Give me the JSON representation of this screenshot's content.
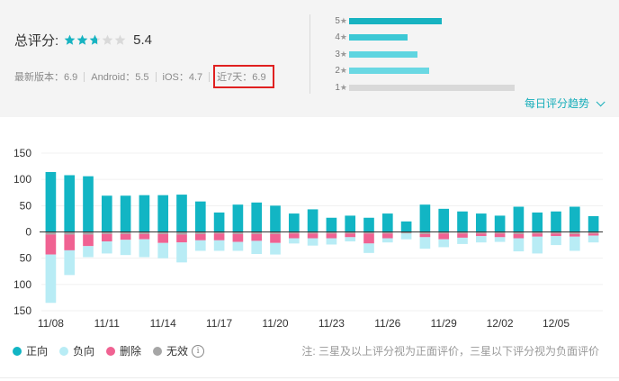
{
  "rating": {
    "label": "总评分:",
    "value": "5.4",
    "stars_filled": 2.7,
    "stars_total": 5,
    "star_color": "#17b3c1",
    "star_empty_color": "#d9d9d9"
  },
  "versions": {
    "latest": "最新版本：6.9",
    "android": "Android：5.5",
    "ios": "iOS：4.7",
    "recent": "近7天：6.9"
  },
  "distribution": [
    {
      "stars": "5",
      "value": 0.38,
      "color": "#17b3c1"
    },
    {
      "stars": "4",
      "value": 0.24,
      "color": "#3cc8d5"
    },
    {
      "stars": "3",
      "value": 0.28,
      "color": "#5fd5e0"
    },
    {
      "stars": "2",
      "value": 0.33,
      "color": "#6ad8e3"
    },
    {
      "stars": "1",
      "value": 0.68,
      "color": "#d9d9d9"
    }
  ],
  "trend_link": "每日评分趋势",
  "legend": {
    "positive": "正向",
    "negative": "负向",
    "deleted": "删除",
    "invalid": "无效"
  },
  "note": "注: 三星及以上评分视为正面评价，三星以下评分视为负面评价",
  "colors": {
    "positive": "#12b5c4",
    "negative": "#b8ecf5",
    "deleted": "#f06292",
    "invalid": "#a6a6a6",
    "accent": "#17aeba"
  },
  "chart_data": {
    "type": "bar",
    "stacked": true,
    "ylim": [
      -150,
      150
    ],
    "yticks": [
      150,
      100,
      50,
      0,
      50,
      100,
      150
    ],
    "ytick_values": [
      150,
      100,
      50,
      0,
      -50,
      -100,
      -150
    ],
    "xtick_labels": [
      "11/08",
      "11/11",
      "11/14",
      "11/17",
      "11/20",
      "11/23",
      "11/26",
      "11/29",
      "12/02",
      "12/05"
    ],
    "categories": [
      "11/08",
      "11/09",
      "11/10",
      "11/11",
      "11/12",
      "11/13",
      "11/14",
      "11/15",
      "11/16",
      "11/17",
      "11/18",
      "11/19",
      "11/20",
      "11/21",
      "11/22",
      "11/23",
      "11/24",
      "11/25",
      "11/26",
      "11/27",
      "11/28",
      "11/29",
      "11/30",
      "12/01",
      "12/02",
      "12/03",
      "12/04",
      "12/05",
      "12/06",
      "12/07"
    ],
    "series": [
      {
        "name": "正向",
        "values": [
          114,
          108,
          106,
          69,
          69,
          70,
          70,
          71,
          58,
          37,
          52,
          56,
          50,
          35,
          43,
          27,
          31,
          27,
          35,
          20,
          52,
          44,
          39,
          35,
          31,
          48,
          37,
          39,
          48,
          30
        ]
      },
      {
        "name": "无效",
        "values": [
          -5,
          -5,
          -5,
          -4,
          -4,
          -4,
          -4,
          -5,
          -4,
          -3,
          -4,
          -4,
          -4,
          -3,
          -3,
          -3,
          -3,
          -3,
          -3,
          -3,
          -4,
          -3,
          -3,
          -3,
          -3,
          -4,
          -3,
          -3,
          -4,
          -3
        ]
      },
      {
        "name": "删除",
        "values": [
          -38,
          -30,
          -22,
          -14,
          -11,
          -10,
          -17,
          -15,
          -12,
          -13,
          -15,
          -13,
          -17,
          -9,
          -9,
          -9,
          -7,
          -19,
          -9,
          0,
          -6,
          -11,
          -8,
          -5,
          -7,
          -8,
          -6,
          -5,
          -5,
          -4
        ]
      },
      {
        "name": "负向",
        "values": [
          -92,
          -47,
          -21,
          -23,
          -29,
          -34,
          -29,
          -38,
          -20,
          -20,
          -17,
          -25,
          -22,
          -10,
          -14,
          -12,
          -8,
          -18,
          -8,
          -11,
          -22,
          -15,
          -12,
          -12,
          -9,
          -25,
          -32,
          -17,
          -27,
          -13
        ]
      }
    ]
  }
}
